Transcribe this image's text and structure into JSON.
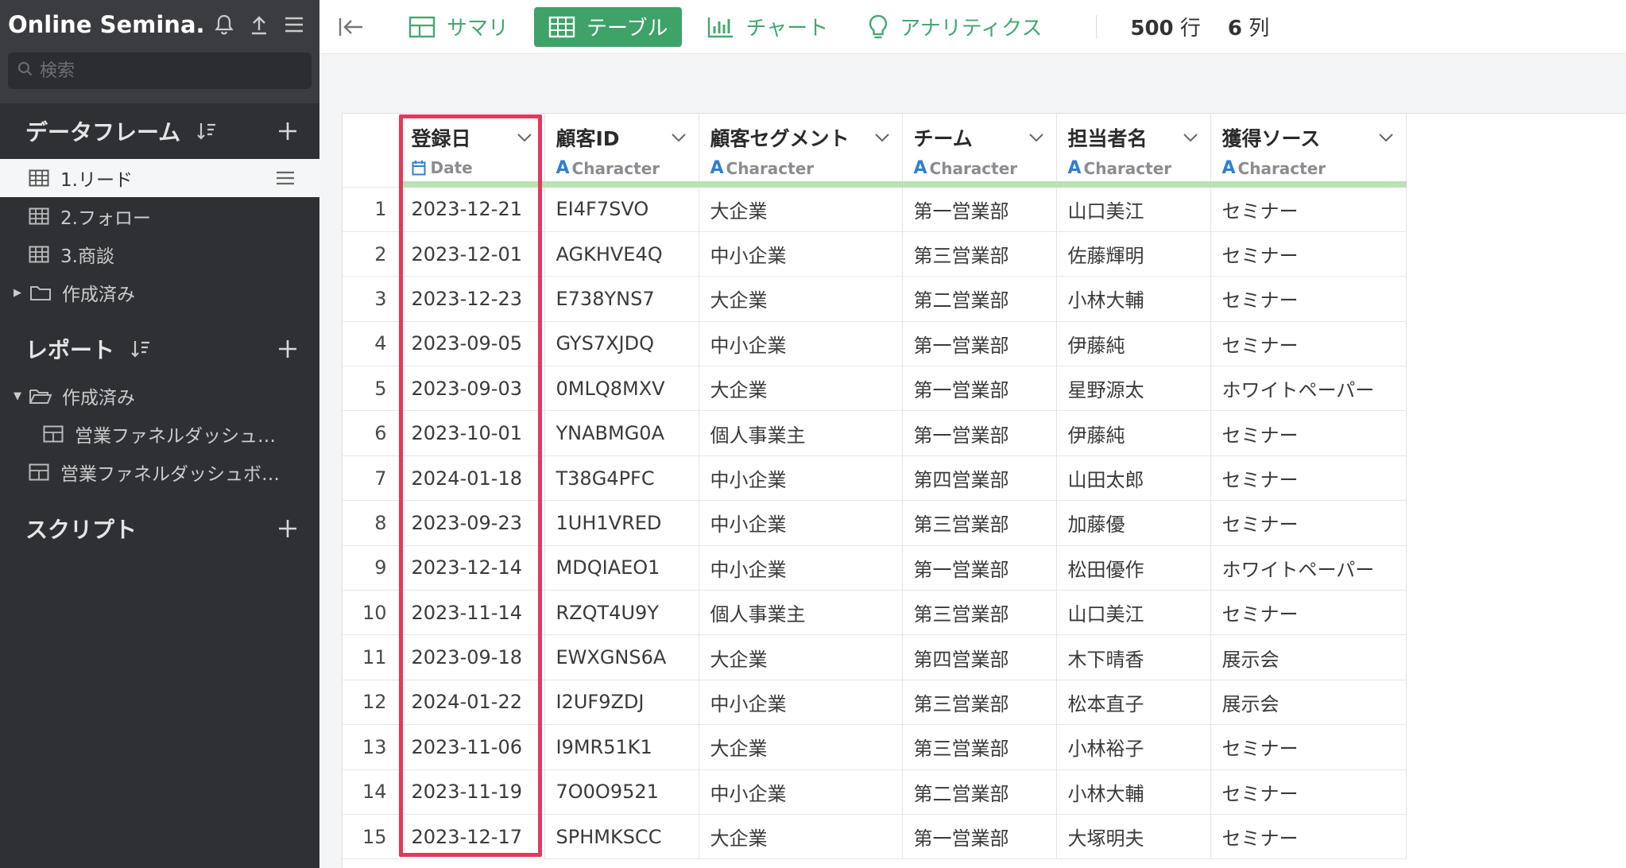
{
  "sidebar": {
    "app_title": "Online Semina...",
    "search_placeholder": "検索",
    "dataframes": {
      "title": "データフレーム",
      "items": [
        {
          "label": "1.リード"
        },
        {
          "label": "2.フォロー"
        },
        {
          "label": "3.商談"
        }
      ],
      "folder": "作成済み"
    },
    "reports": {
      "title": "レポート",
      "folder": "作成済み",
      "child_item": "営業ファネルダッシュ…",
      "item": "営業ファネルダッシュボ…"
    },
    "scripts": {
      "title": "スクリプト"
    }
  },
  "toolbar": {
    "tabs": [
      "サマリ",
      "テーブル",
      "チャート",
      "アナリティクス"
    ],
    "active_tab": "テーブル",
    "row_count": "500",
    "row_unit": "行",
    "col_count": "6",
    "col_unit": "列"
  },
  "table": {
    "columns": [
      {
        "name": "登録日",
        "type": "Date"
      },
      {
        "name": "顧客ID",
        "type": "Character"
      },
      {
        "name": "顧客セグメント",
        "type": "Character"
      },
      {
        "name": "チーム",
        "type": "Character"
      },
      {
        "name": "担当者名",
        "type": "Character"
      },
      {
        "name": "獲得ソース",
        "type": "Character"
      }
    ],
    "rows": [
      [
        "1",
        "2023-12-21",
        "EI4F7SVO",
        "大企業",
        "第一営業部",
        "山口美江",
        "セミナー"
      ],
      [
        "2",
        "2023-12-01",
        "AGKHVE4Q",
        "中小企業",
        "第三営業部",
        "佐藤輝明",
        "セミナー"
      ],
      [
        "3",
        "2023-12-23",
        "E738YNS7",
        "大企業",
        "第二営業部",
        "小林大輔",
        "セミナー"
      ],
      [
        "4",
        "2023-09-05",
        "GYS7XJDQ",
        "中小企業",
        "第一営業部",
        "伊藤純",
        "セミナー"
      ],
      [
        "5",
        "2023-09-03",
        "0MLQ8MXV",
        "大企業",
        "第一営業部",
        "星野源太",
        "ホワイトペーパー"
      ],
      [
        "6",
        "2023-10-01",
        "YNABMG0A",
        "個人事業主",
        "第一営業部",
        "伊藤純",
        "セミナー"
      ],
      [
        "7",
        "2024-01-18",
        "T38G4PFC",
        "中小企業",
        "第四営業部",
        "山田太郎",
        "セミナー"
      ],
      [
        "8",
        "2023-09-23",
        "1UH1VRED",
        "中小企業",
        "第三営業部",
        "加藤優",
        "セミナー"
      ],
      [
        "9",
        "2023-12-14",
        "MDQIAEO1",
        "中小企業",
        "第一営業部",
        "松田優作",
        "ホワイトペーパー"
      ],
      [
        "10",
        "2023-11-14",
        "RZQT4U9Y",
        "個人事業主",
        "第三営業部",
        "山口美江",
        "セミナー"
      ],
      [
        "11",
        "2023-09-18",
        "EWXGNS6A",
        "大企業",
        "第四営業部",
        "木下晴香",
        "展示会"
      ],
      [
        "12",
        "2024-01-22",
        "I2UF9ZDJ",
        "中小企業",
        "第三営業部",
        "松本直子",
        "展示会"
      ],
      [
        "13",
        "2023-11-06",
        "I9MR51K1",
        "大企業",
        "第三営業部",
        "小林裕子",
        "セミナー"
      ],
      [
        "14",
        "2023-11-19",
        "7O0O9521",
        "中小企業",
        "第二営業部",
        "小林大輔",
        "セミナー"
      ],
      [
        "15",
        "2023-12-17",
        "SPHMKSCC",
        "大企業",
        "第一営業部",
        "大塚明夫",
        "セミナー"
      ]
    ]
  },
  "colors": {
    "accent": "#3ea269",
    "highlight": "#e3395c",
    "sidebar_bg": "#2f3033"
  }
}
